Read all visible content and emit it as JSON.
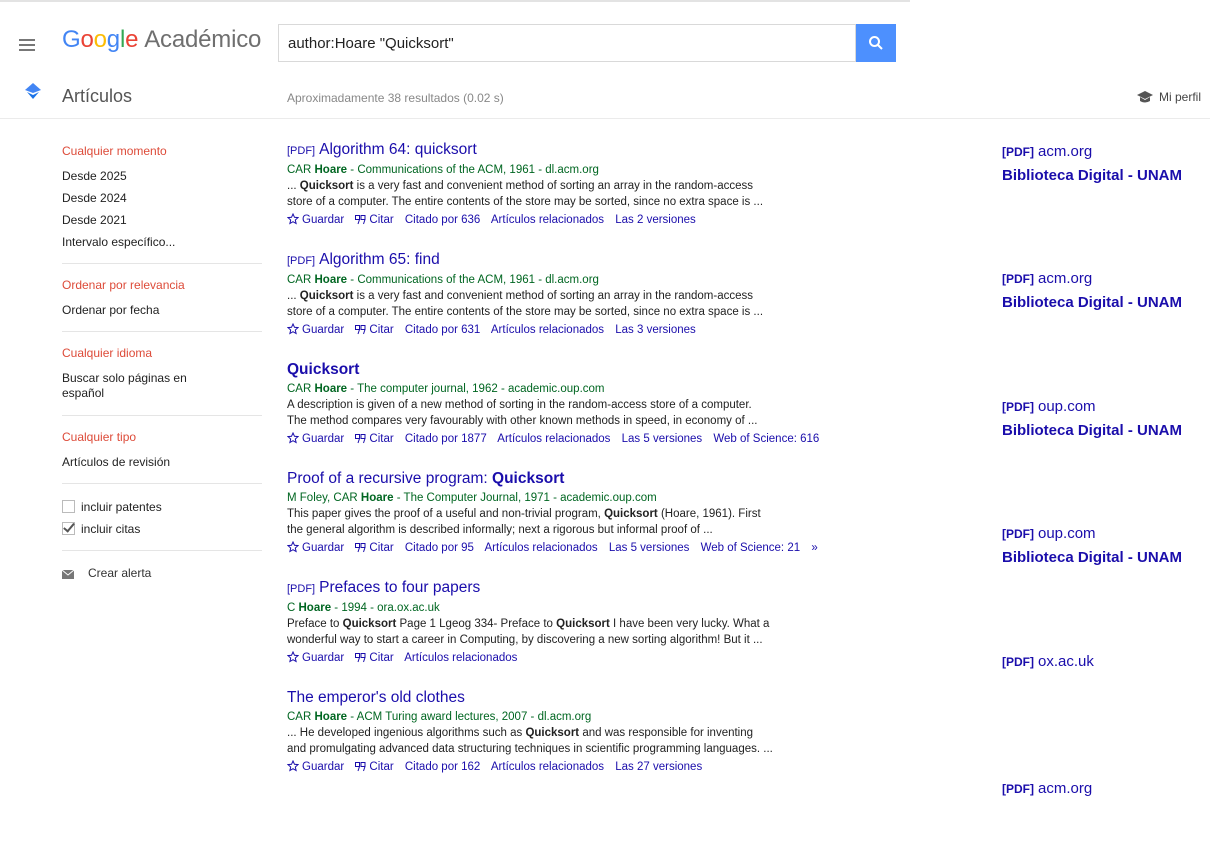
{
  "header": {
    "logo_letters": [
      "G",
      "o",
      "o",
      "g",
      "l",
      "e"
    ],
    "logo_suffix": "Académico",
    "search_query": "author:Hoare \"Quicksort\""
  },
  "subbar": {
    "section_label": "Artículos",
    "results_count": "Aproximadamente 38 resultados (0.02 s)",
    "profile_label": "Mi perfil"
  },
  "sidebar": {
    "time_heading": "Cualquier momento",
    "time_items": [
      "Desde 2025",
      "Desde 2024",
      "Desde 2021",
      "Intervalo específico..."
    ],
    "sort_heading": "Ordenar por relevancia",
    "sort_items": [
      "Ordenar por fecha"
    ],
    "lang_heading": "Cualquier idioma",
    "lang_items": [
      "Buscar solo páginas en español"
    ],
    "type_heading": "Cualquier tipo",
    "type_items": [
      "Artículos de revisión"
    ],
    "include_patents": "incluir patentes",
    "include_citations": "incluir citas",
    "create_alert": "Crear alerta"
  },
  "results": [
    {
      "tag": "[PDF]",
      "title": "Algorithm 64: quicksort",
      "meta_pre": "CAR ",
      "meta_bold": "Hoare",
      "meta_post": " - Communications of the ACM, 1961 - dl.acm.org",
      "snippet1_pre": "... ",
      "snippet1_bold": "Quicksort",
      "snippet1_post": " is a very fast and convenient method of sorting an array in the random-access",
      "snippet2": "store of a computer. The entire contents of the store may be sorted, since no extra space is ...",
      "links": [
        "Guardar",
        "Citar",
        "Citado por 636",
        "Artículos relacionados",
        "Las 2 versiones"
      ],
      "side_source": "acm.org",
      "side_library": "Biblioteca Digital - UNAM"
    },
    {
      "tag": "[PDF]",
      "title": "Algorithm 65: find",
      "meta_pre": "CAR ",
      "meta_bold": "Hoare",
      "meta_post": " - Communications of the ACM, 1961 - dl.acm.org",
      "snippet1_pre": "... ",
      "snippet1_bold": "Quicksort",
      "snippet1_post": " is a very fast and convenient method of sorting an array in the random-access",
      "snippet2": "store of a computer. The entire contents of the store may be sorted, since no extra space is ...",
      "links": [
        "Guardar",
        "Citar",
        "Citado por 631",
        "Artículos relacionados",
        "Las 3 versiones"
      ],
      "side_source": "acm.org",
      "side_library": "Biblioteca Digital - UNAM"
    },
    {
      "tag": "",
      "title": "Quicksort",
      "meta_pre": "CAR ",
      "meta_bold": "Hoare",
      "meta_post": " - The computer journal, 1962 - academic.oup.com",
      "snippet1_pre": "A description is given of a new method of sorting in the random-access store of a computer.",
      "snippet1_bold": "",
      "snippet1_post": "",
      "snippet2": "The method compares very favourably with other known methods in speed, in economy of ...",
      "links": [
        "Guardar",
        "Citar",
        "Citado por 1877",
        "Artículos relacionados",
        "Las 5 versiones",
        "Web of Science: 616"
      ],
      "side_source": "oup.com",
      "side_library": "Biblioteca Digital - UNAM"
    },
    {
      "tag": "",
      "title_pre": "Proof of a recursive program: ",
      "title_bold": "Quicksort",
      "meta_pre": "M Foley, CAR ",
      "meta_bold": "Hoare",
      "meta_post": " - The Computer Journal, 1971 - academic.oup.com",
      "snippet1_pre": "This paper gives the proof of a useful and non-trivial program, ",
      "snippet1_bold": "Quicksort",
      "snippet1_post": " (Hoare, 1961). First",
      "snippet2": "the general algorithm is described informally; next a rigorous but informal proof of ...",
      "links": [
        "Guardar",
        "Citar",
        "Citado por 95",
        "Artículos relacionados",
        "Las 5 versiones",
        "Web of Science: 21"
      ],
      "side_source": "oup.com",
      "side_library": "Biblioteca Digital - UNAM"
    },
    {
      "tag": "[PDF]",
      "title": "Prefaces to four papers",
      "meta_pre": "C ",
      "meta_bold": "Hoare",
      "meta_post": " - 1994 - ora.ox.ac.uk",
      "snippet1_pre": "Preface to ",
      "snippet1_bold": "Quicksort",
      "snippet1_mid": " Page 1 Lgeog 334- Preface to ",
      "snippet1_bold2": "Quicksort",
      "snippet1_post": " I have been very lucky. What a",
      "snippet2": "wonderful way to start a career in Computing, by discovering a new sorting algorithm! But it ...",
      "links": [
        "Guardar",
        "Citar",
        "Artículos relacionados"
      ],
      "side_source": "ox.ac.uk",
      "side_library": ""
    },
    {
      "tag": "",
      "title": "The emperor's old clothes",
      "meta_pre": "CAR ",
      "meta_bold": "Hoare",
      "meta_post": " - ACM Turing award lectures, 2007 - dl.acm.org",
      "snippet1_pre": "... He developed ingenious algorithms such as ",
      "snippet1_bold": "Quicksort",
      "snippet1_post": " and was responsible for inventing",
      "snippet2": "and promulgating advanced data structuring techniques in scientific programming languages. ...",
      "links": [
        "Guardar",
        "Citar",
        "Citado por 162",
        "Artículos relacionados",
        "Las 27 versiones"
      ],
      "side_source": "acm.org",
      "side_library": ""
    }
  ],
  "side_pdf_tag": "[PDF]"
}
